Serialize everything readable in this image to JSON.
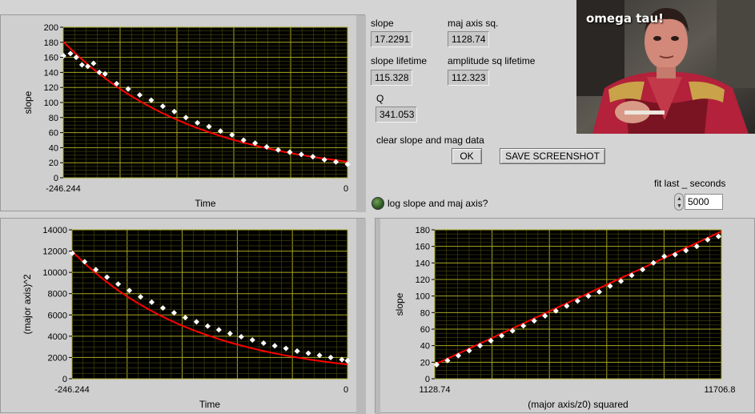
{
  "indicators": {
    "slope_label": "slope",
    "slope_value": "17.2291",
    "maj_label": "maj axis sq.",
    "maj_value": "1128.74",
    "slope_life_label": "slope lifetime",
    "slope_life_value": "115.328",
    "amp_life_label": "amplitude sq lifetime",
    "amp_life_value": "112.323",
    "q_label": "Q",
    "q_value": "341.053",
    "clear_label": "clear slope and mag data"
  },
  "buttons": {
    "ok_label": "OK",
    "screenshot_label": "SAVE SCREENSHOT"
  },
  "toggle": {
    "log_label": "log slope and maj axis?"
  },
  "fit": {
    "label": "fit last _ seconds",
    "value": "5000"
  },
  "image": {
    "caption": "omega tau!"
  },
  "colors": {
    "plot_bg": "#000000",
    "grid": "#8d8d00",
    "data": "#ffffff",
    "fit": "#ff0000"
  },
  "chart_data": [
    {
      "type": "scatter",
      "ylabel": "slope",
      "xlabel": "Time",
      "x_start_label": "-246.244",
      "x_end_label": "0",
      "xlim": [
        -246.244,
        0
      ],
      "ylim": [
        0,
        200
      ],
      "yticks": [
        "0",
        "20",
        "40",
        "60",
        "80",
        "100",
        "120",
        "140",
        "160",
        "180",
        "200"
      ],
      "x": [
        -246,
        -240,
        -235,
        -230,
        -225,
        -220,
        -215,
        -210,
        -200,
        -190,
        -180,
        -170,
        -160,
        -150,
        -140,
        -130,
        -120,
        -110,
        -100,
        -90,
        -80,
        -70,
        -60,
        -50,
        -40,
        -30,
        -20,
        -10,
        0
      ],
      "y": [
        162,
        165,
        160,
        150,
        148,
        152,
        140,
        138,
        125,
        118,
        110,
        103,
        95,
        88,
        80,
        73,
        68,
        62,
        57,
        50,
        46,
        41,
        37,
        34,
        31,
        28,
        24,
        21,
        18
      ],
      "fit": {
        "amplitude": 181,
        "lifetime": 115.328
      }
    },
    {
      "type": "scatter",
      "ylabel": "(major axis)^2",
      "xlabel": "Time",
      "x_start_label": "-246.244",
      "x_end_label": "0",
      "xlim": [
        -246.244,
        0
      ],
      "ylim": [
        0,
        14000
      ],
      "yticks": [
        "0",
        "2000",
        "4000",
        "6000",
        "8000",
        "10000",
        "12000",
        "14000"
      ],
      "x": [
        -246,
        -235,
        -225,
        -215,
        -205,
        -195,
        -185,
        -175,
        -165,
        -155,
        -145,
        -135,
        -125,
        -115,
        -105,
        -95,
        -85,
        -75,
        -65,
        -55,
        -45,
        -35,
        -25,
        -15,
        -5,
        0
      ],
      "y": [
        11800,
        11000,
        10250,
        9550,
        8900,
        8300,
        7700,
        7200,
        6650,
        6200,
        5750,
        5350,
        4950,
        4600,
        4250,
        3950,
        3650,
        3350,
        3100,
        2850,
        2600,
        2400,
        2200,
        2000,
        1800,
        1700
      ],
      "fit": {
        "amplitude": 12000,
        "lifetime": 112.323
      }
    },
    {
      "type": "scatter",
      "ylabel": "slope",
      "xlabel": "(major axis/z0) squared",
      "x_start_label": "1128.74",
      "x_end_label": "11706.8",
      "xlim": [
        1128.74,
        11706.8
      ],
      "ylim": [
        0,
        180
      ],
      "yticks": [
        "0",
        "20",
        "40",
        "60",
        "80",
        "100",
        "120",
        "140",
        "160",
        "180"
      ],
      "x": [
        1200,
        1600,
        2000,
        2400,
        2800,
        3200,
        3600,
        4000,
        4400,
        4800,
        5200,
        5600,
        6000,
        6400,
        6800,
        7200,
        7600,
        8000,
        8400,
        8800,
        9200,
        9600,
        10000,
        10400,
        10800,
        11200,
        11600
      ],
      "y": [
        17,
        22,
        28,
        34,
        40,
        46,
        52,
        58,
        64,
        70,
        76,
        82,
        88,
        94,
        100,
        105,
        112,
        118,
        125,
        132,
        140,
        148,
        150,
        155,
        160,
        168,
        172
      ],
      "fit": {
        "intercept": 17.2291,
        "slope": 0.0152
      }
    }
  ]
}
